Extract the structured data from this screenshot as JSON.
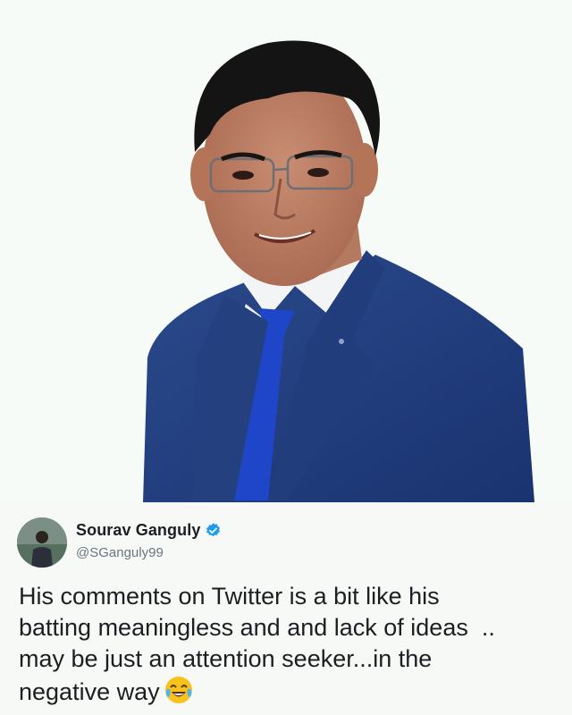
{
  "tweet": {
    "author_name": "Sourav Ganguly",
    "author_handle": "@SGanguly99",
    "text": "His comments on Twitter is a bit like his\nbatting meaningless and and lack of ideas  ..\nmay be just an attention seeker...in the\nnegative way",
    "emoji_icon": "face-with-tears-of-joy-icon",
    "verified_icon": "verified-badge-icon"
  },
  "colors": {
    "suit": "#1e3a78",
    "tie": "#1f46c8",
    "verified": "#1d9bf0",
    "background": "#f6faf6"
  }
}
